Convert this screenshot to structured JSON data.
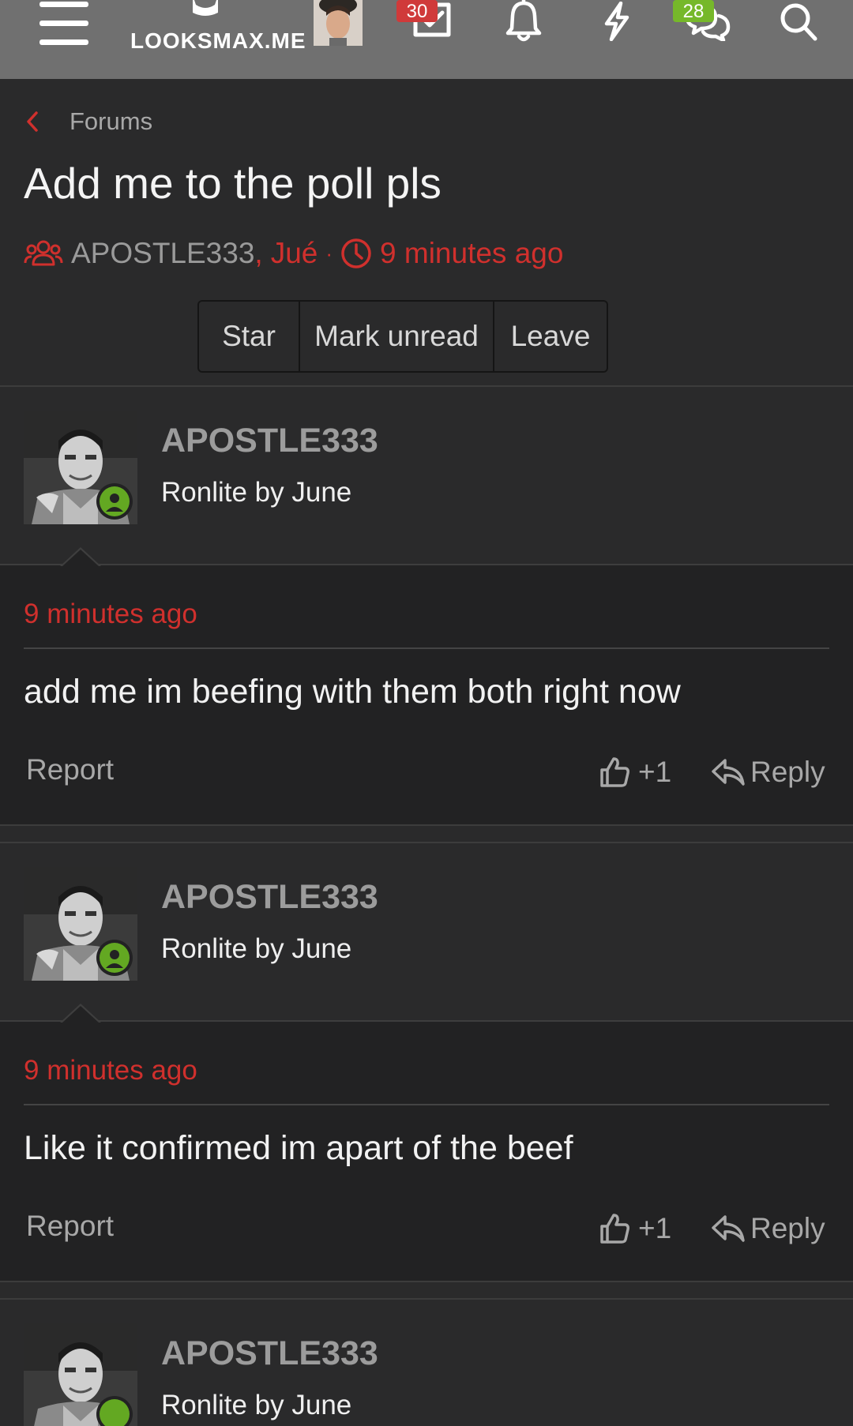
{
  "nav": {
    "logo_text": "LOOKSMAX.ME",
    "inbox_badge": "30",
    "chat_badge": "28"
  },
  "breadcrumb": {
    "label": "Forums"
  },
  "thread": {
    "title": "Add me to the poll pls",
    "participant_1": "APOSTLE333",
    "separator": ",",
    "participant_2": "Jué",
    "dot": "·",
    "time": "9 minutes ago"
  },
  "actions": {
    "star": "Star",
    "mark_unread": "Mark unread",
    "leave": "Leave"
  },
  "messages": [
    {
      "username": "APOSTLE333",
      "user_title": "Ronlite by June",
      "time": "9 minutes ago",
      "body": "add me im beefing with them both right now",
      "report": "Report",
      "reactions": "+1",
      "reply": "Reply"
    },
    {
      "username": "APOSTLE333",
      "user_title": "Ronlite by June",
      "time": "9 minutes ago",
      "body": "Like it confirmed im apart of the beef",
      "report": "Report",
      "reactions": "+1",
      "reply": "Reply"
    },
    {
      "username": "APOSTLE333",
      "user_title": "Ronlite by June"
    }
  ],
  "colors": {
    "accent_red": "#d0302d",
    "online_green": "#63a822",
    "badge_red": "#d03a3a",
    "badge_green": "#76b82a"
  }
}
